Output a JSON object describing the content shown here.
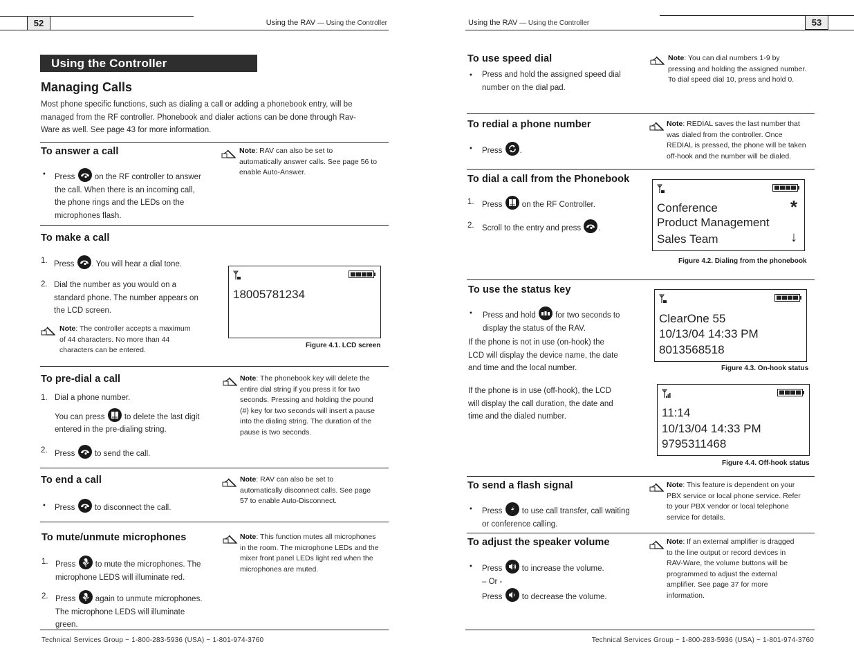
{
  "left_page": {
    "page_number": "52",
    "running_head": {
      "section": "Using the RAV",
      "dash": " — ",
      "subsection": "Using the Controller"
    },
    "chapter_title": "Using the Controller",
    "heading": "Managing Calls",
    "intro": "Most phone specific functions, such as dialing a call or adding a phonebook entry, will be managed from the RF controller. Phonebook and dialer actions can be done through Rav-Ware as well. See page 43 for more information.",
    "intro_lines": [
      "Most phone specific functions, such as dialing a call or adding a phonebook entry, will be",
      "managed from the RF controller. Phonebook and dialer actions can be done through Rav-",
      "Ware as well. See page 43 for more information."
    ],
    "sections": {
      "answer": {
        "title": "To answer a call",
        "bullet_pre": "Press",
        "bullet_icon": "phone-handset-icon",
        "bullet_lines": [
          " on the RF controller to answer",
          "the call. When there is an incoming call,",
          "the phone rings and the LEDs on the",
          "microphones flash."
        ],
        "note_label": "Note",
        "note_lines": [
          ": RAV can also be set to",
          "automatically answer calls. See page 56 to",
          "enable Auto-Answer."
        ]
      },
      "make": {
        "title": "To make a call",
        "step1_num": "1.",
        "step1_pre": "Press",
        "step1_icon": "phone-handset-icon",
        "step1_post": ". You will hear a dial tone.",
        "step2_num": "2.",
        "step2_lines": [
          "Dial the number as you would on a",
          "standard phone. The number appears on",
          "the LCD screen."
        ],
        "note_label": "Note",
        "note_lines": [
          ": The controller accepts a maximum",
          "of 44 characters. No more than 44",
          "characters can be entered."
        ],
        "lcd_lines": [
          "18005781234"
        ],
        "figure_caption": "Figure 4.1. LCD screen"
      },
      "predial": {
        "title": "To pre-dial a call",
        "step1_num": "1.",
        "step1_text": "Dial a phone number.",
        "step1b_pre": "You can press",
        "step1b_icon": "phonebook-icon",
        "step1b_post": " to delete the last digit",
        "step1c_text": "entered in the pre-dialing string.",
        "step2_num": "2.",
        "step2_pre": "Press",
        "step2_icon": "phone-handset-icon",
        "step2_post": " to send the call.",
        "note_label": "Note",
        "note_lines": [
          ": The phonebook key will delete the",
          "entire dial string if you press it for two",
          "seconds. Pressing and holding the pound",
          "(#) key for two seconds will insert a pause",
          "into the dialing string. The duration of the",
          "pause is two seconds."
        ]
      },
      "end": {
        "title": "To end a call",
        "bullet_pre": "Press",
        "bullet_icon": "phone-handset-icon",
        "bullet_post": " to disconnect the call.",
        "note_label": "Note",
        "note_lines": [
          ": RAV can also be set to",
          "automatically disconnect calls. See page",
          "57 to enable Auto-Disconnect."
        ]
      },
      "mute": {
        "title": "To mute/unmute microphones",
        "step1_num": "1.",
        "step1_pre": "Press",
        "step1_icon": "microphone-mute-icon",
        "step1_post": " to mute the microphones. The",
        "step1_line2": "microphone LEDS will illuminate red.",
        "step2_num": "2.",
        "step2_pre": "Press",
        "step2_icon": "microphone-mute-icon",
        "step2_post": " again to unmute microphones.",
        "step2_lines": [
          "The microphone LEDS will illuminate",
          "green."
        ],
        "note_label": "Note",
        "note_lines": [
          ": This function mutes all microphones",
          "in the room. The microphone LEDs and the",
          "mixer front panel LEDs light red when the",
          "microphones are muted."
        ]
      }
    },
    "footer": "Technical Services Group ~ 1-800-283-5936 (USA) ~ 1-801-974-3760"
  },
  "right_page": {
    "page_number": "53",
    "running_head": {
      "section": "Using the RAV",
      "dash": " — ",
      "subsection": "Using the Controller"
    },
    "sections": {
      "speed": {
        "title": "To use speed dial",
        "bullet_lines": [
          "Press and hold the assigned speed dial",
          "number on the dial pad."
        ],
        "note_label": "Note",
        "note_lines": [
          ": You can dial numbers 1-9 by",
          "pressing and holding the assigned number.",
          "To dial speed dial 10, press and hold 0."
        ]
      },
      "redial": {
        "title": "To redial a phone number",
        "bullet_pre": "Press",
        "bullet_icon": "redial-icon",
        "bullet_post": ".",
        "note_label": "Note",
        "note_lines": [
          ": REDIAL saves the last number that",
          "was dialed from the controller. Once",
          "REDIAL is pressed, the phone will be taken",
          "off-hook and the number will be dialed."
        ]
      },
      "phonebook": {
        "title": "To dial a call from the Phonebook",
        "step1_num": "1.",
        "step1_pre": "Press",
        "step1_icon": "phonebook-icon",
        "step1_post": " on the RF Controller.",
        "step2_num": "2.",
        "step2_pre": "Scroll to the entry and press",
        "step2_icon": "phone-handset-icon",
        "step2_post": ".",
        "lcd_lines": [
          "Conference",
          "Product Management",
          "Sales Team"
        ],
        "lcd_marker_star": "*",
        "lcd_marker_arrow": "↓",
        "figure_caption": "Figure 4.2. Dialing from the phonebook"
      },
      "status": {
        "title": "To use the status key",
        "bullet_pre": "Press and hold",
        "bullet_icon": "status-icon",
        "bullet_post": " for two seconds to",
        "bullet_line2": "display the status of the RAV.",
        "para1_lines": [
          "If the phone is not in use (on-hook) the",
          "LCD will display the device name, the date",
          "and time and the local number."
        ],
        "para2_lines": [
          "If the phone is in use (off-hook), the LCD",
          "will display the call duration, the date and",
          "time and the dialed number."
        ],
        "lcd_onhook_lines": [
          "ClearOne 55",
          "10/13/04  14:33 PM",
          "8013568518"
        ],
        "figure_onhook_caption": "Figure 4.3. On-hook status",
        "lcd_offhook_lines": [
          "11:14",
          "10/13/04  14:33 PM",
          "9795311468"
        ],
        "figure_offhook_caption": "Figure 4.4. Off-hook status"
      },
      "flash": {
        "title": "To send a flash signal",
        "bullet_pre": "Press",
        "bullet_icon": "flash-icon",
        "bullet_post": " to use call transfer, call waiting",
        "bullet_line2": "or conference calling.",
        "note_label": "Note",
        "note_lines": [
          ": This feature is dependent on your",
          "PBX service or local phone service. Refer",
          "to your PBX vendor or local telephone",
          "service for details."
        ]
      },
      "volume": {
        "title": "To adjust the speaker volume",
        "bullet_pre": "Press",
        "bullet_icon_up": "volume-up-icon",
        "bullet_post": " to increase the volume.",
        "or_text": "– Or -",
        "line3_pre": "Press",
        "bullet_icon_down": "volume-down-icon",
        "line3_post": " to decrease the volume.",
        "note_label": "Note",
        "note_lines": [
          ": If an external amplifier is dragged",
          "to the line output or record devices in",
          "RAV-Ware, the volume buttons will be",
          "programmed to adjust the external",
          "amplifier. See page 37 for more",
          "information."
        ]
      }
    },
    "footer": "Technical Services Group ~ 1-800-283-5936 (USA) ~ 1-801-974-3760"
  }
}
